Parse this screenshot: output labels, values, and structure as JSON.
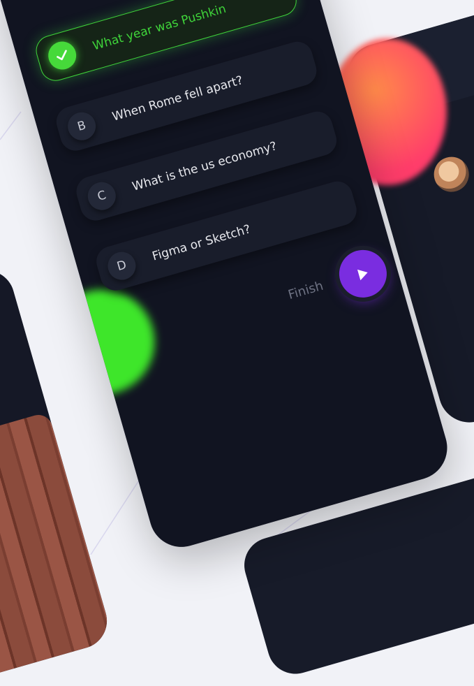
{
  "quiz": {
    "options": [
      {
        "letter": "",
        "text": "What year was Pushkin",
        "correct": true
      },
      {
        "letter": "B",
        "text": "When Rome fell apart?",
        "correct": false
      },
      {
        "letter": "C",
        "text": "What is the us economy?",
        "correct": false
      },
      {
        "letter": "D",
        "text": "Figma or Sketch?",
        "correct": false
      }
    ],
    "finish_label": "Finish"
  },
  "icons": {
    "check": "check-icon",
    "play": "play-icon",
    "back": "back-icon",
    "menu": "menu-icon"
  },
  "colors": {
    "accent_green": "#3fd43a",
    "accent_purple": "#7a2de0",
    "background": "#111421"
  }
}
